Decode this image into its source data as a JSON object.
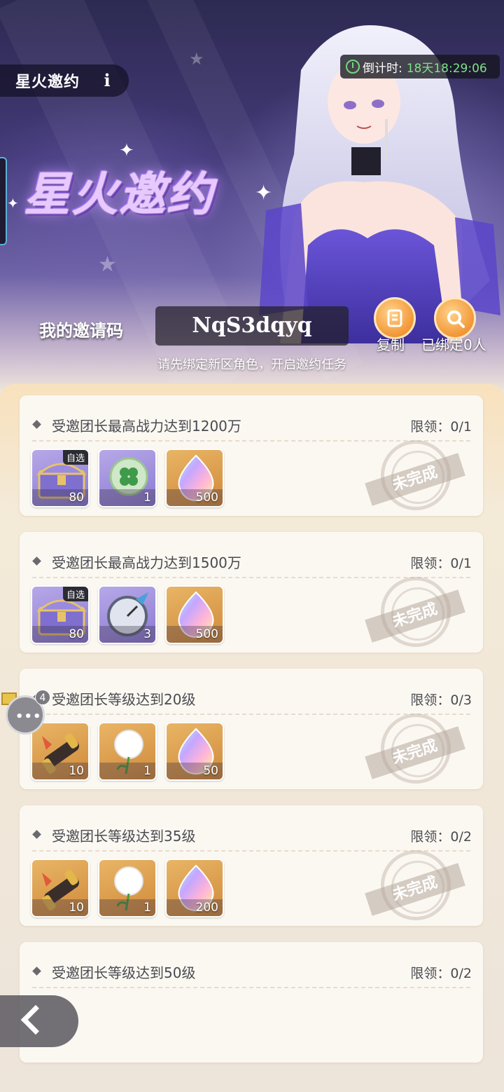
{
  "header": {
    "title": "星火邀约",
    "info_glyph": "i",
    "countdown_label": "倒计时:",
    "countdown_value": "18天18:29:06",
    "logo_text": "星火邀约",
    "invite_label": "我的邀请码",
    "invite_code": "NqS3dqyq",
    "copy_label": "复制",
    "bound_label": "已绑定0人",
    "hint": "请先绑定新区角色，开启邀约任务"
  },
  "status_stamp": "未完成",
  "tasks": [
    {
      "name": "受邀团长最高战力达到1200万",
      "limit": "限领：0/1",
      "rewards": [
        {
          "icon": "chest-icon",
          "count": "80",
          "tag": "自选",
          "bg": "purple"
        },
        {
          "icon": "clover-orb-icon",
          "count": "1",
          "bg": "purple"
        },
        {
          "icon": "rainbow-crystal-icon",
          "count": "500",
          "bg": "gold"
        }
      ]
    },
    {
      "name": "受邀团长最高战力达到1500万",
      "limit": "限领：0/1",
      "rewards": [
        {
          "icon": "chest-icon",
          "count": "80",
          "tag": "自选",
          "bg": "purple"
        },
        {
          "icon": "compass-icon",
          "count": "3",
          "bg": "purple"
        },
        {
          "icon": "rainbow-crystal-icon",
          "count": "500",
          "bg": "gold"
        }
      ]
    },
    {
      "name": "受邀团长等级达到20级",
      "limit": "限领：0/3",
      "rewards": [
        {
          "icon": "scroll-icon",
          "count": "10",
          "bg": "gold"
        },
        {
          "icon": "dandelion-icon",
          "count": "1",
          "bg": "gold"
        },
        {
          "icon": "rainbow-crystal-icon",
          "count": "50",
          "bg": "gold"
        }
      ]
    },
    {
      "name": "受邀团长等级达到35级",
      "limit": "限领：0/2",
      "rewards": [
        {
          "icon": "scroll-icon",
          "count": "10",
          "bg": "gold"
        },
        {
          "icon": "dandelion-icon",
          "count": "1",
          "bg": "gold"
        },
        {
          "icon": "rainbow-crystal-icon",
          "count": "200",
          "bg": "gold"
        }
      ]
    },
    {
      "name": "受邀团长等级达到50级",
      "limit": "限领：0/2",
      "rewards": []
    }
  ],
  "chat_badge": "4",
  "colors": {
    "countdown_green": "#7ee38a",
    "button_orange": "#f08e2a",
    "panel_bg": "#fbf8f2"
  }
}
